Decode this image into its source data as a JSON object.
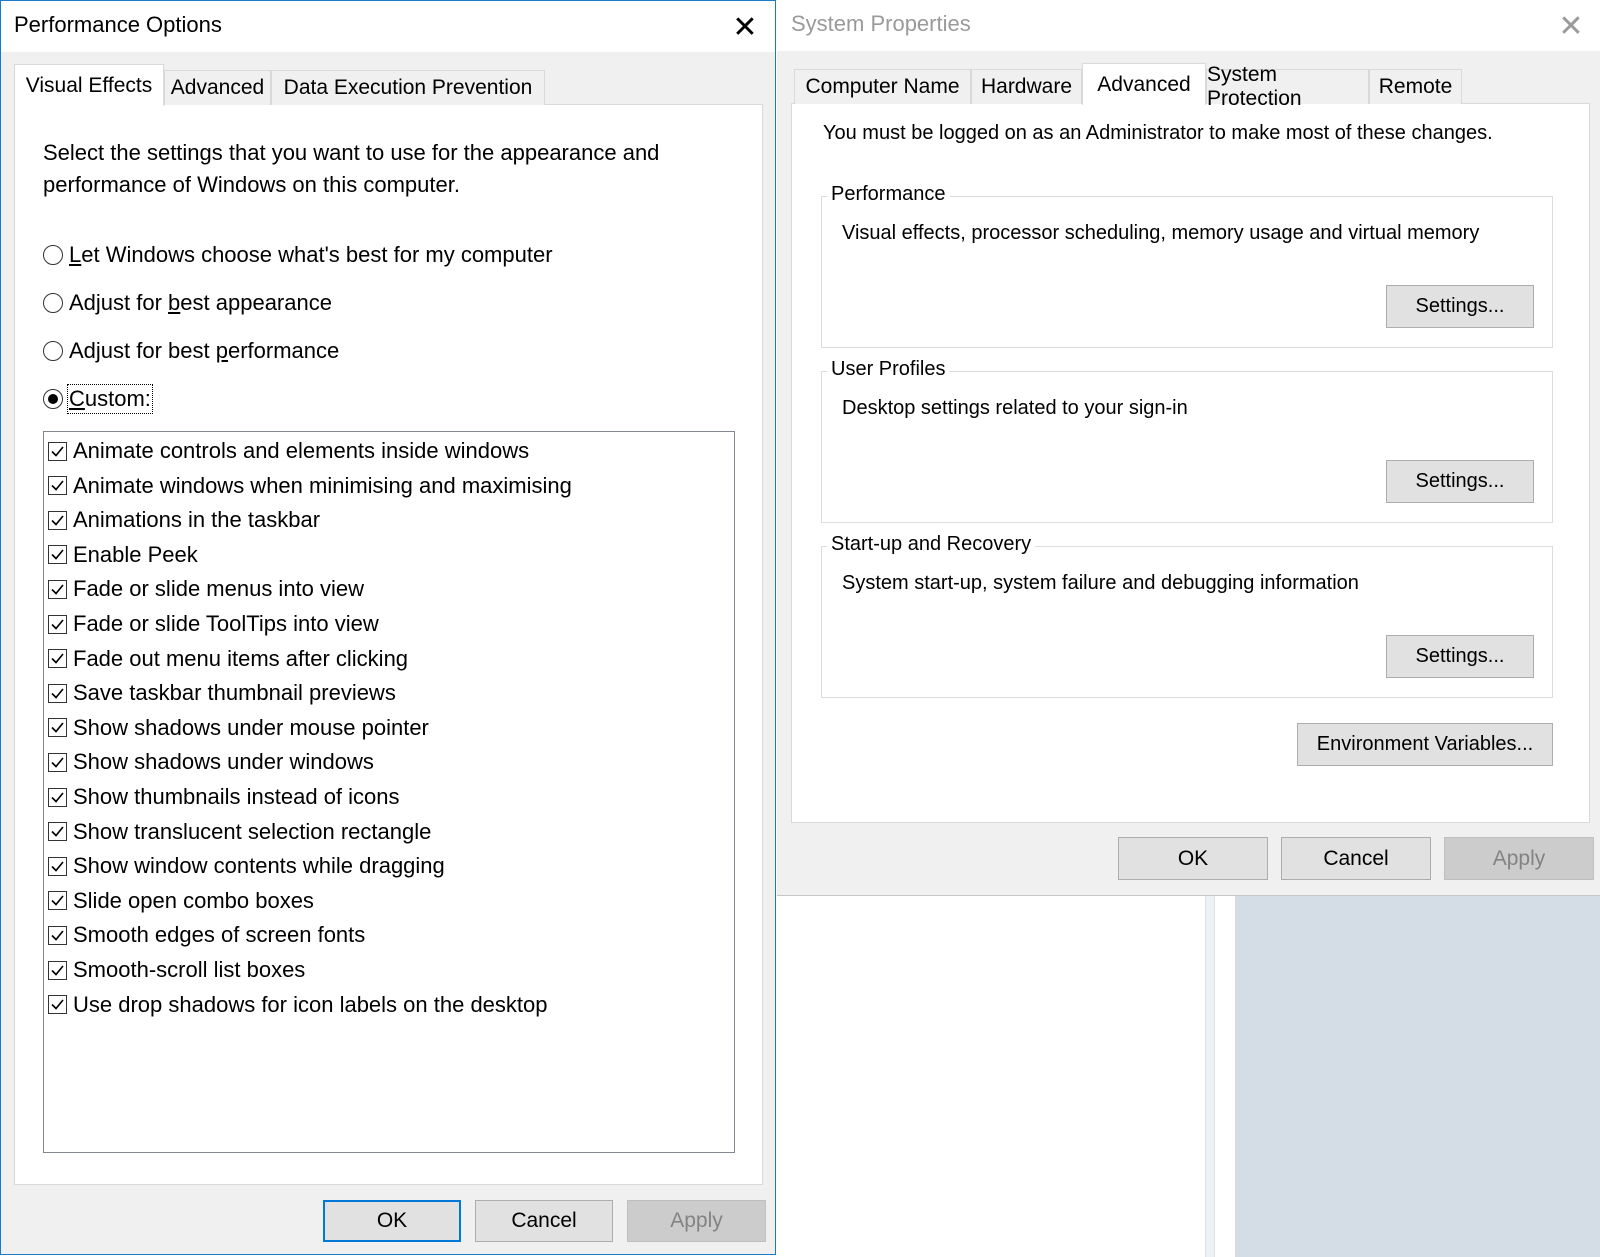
{
  "performance_options": {
    "title": "Performance Options",
    "tabs": [
      {
        "label": "Visual Effects",
        "active": true
      },
      {
        "label": "Advanced",
        "active": false
      },
      {
        "label": "Data Execution Prevention",
        "active": false
      }
    ],
    "description": "Select the settings that you want to use for the appearance and performance of Windows on this computer.",
    "radios": [
      {
        "pre": "",
        "key": "L",
        "post": "et Windows choose what's best for my computer",
        "selected": false
      },
      {
        "pre": "Adjust for ",
        "key": "b",
        "post": "est appearance",
        "selected": false
      },
      {
        "pre": "Adjust for best ",
        "key": "p",
        "post": "erformance",
        "selected": false
      },
      {
        "pre": "",
        "key": "C",
        "post": "ustom:",
        "selected": true
      }
    ],
    "effects": [
      {
        "label": "Animate controls and elements inside windows",
        "checked": true
      },
      {
        "label": "Animate windows when minimising and maximising",
        "checked": true
      },
      {
        "label": "Animations in the taskbar",
        "checked": true
      },
      {
        "label": "Enable Peek",
        "checked": true
      },
      {
        "label": "Fade or slide menus into view",
        "checked": true
      },
      {
        "label": "Fade or slide ToolTips into view",
        "checked": true
      },
      {
        "label": "Fade out menu items after clicking",
        "checked": true
      },
      {
        "label": "Save taskbar thumbnail previews",
        "checked": true
      },
      {
        "label": "Show shadows under mouse pointer",
        "checked": true
      },
      {
        "label": "Show shadows under windows",
        "checked": true
      },
      {
        "label": "Show thumbnails instead of icons",
        "checked": true
      },
      {
        "label": "Show translucent selection rectangle",
        "checked": true
      },
      {
        "label": "Show window contents while dragging",
        "checked": true
      },
      {
        "label": "Slide open combo boxes",
        "checked": true
      },
      {
        "label": "Smooth edges of screen fonts",
        "checked": true
      },
      {
        "label": "Smooth-scroll list boxes",
        "checked": true
      },
      {
        "label": "Use drop shadows for icon labels on the desktop",
        "checked": true
      }
    ],
    "buttons": {
      "ok": "OK",
      "cancel": "Cancel",
      "apply": "Apply"
    },
    "close_glyph": "✕"
  },
  "system_properties": {
    "title": "System Properties",
    "tabs": [
      {
        "label": "Computer Name",
        "active": false
      },
      {
        "label": "Hardware",
        "active": false
      },
      {
        "label": "Advanced",
        "active": true
      },
      {
        "label": "System Protection",
        "active": false
      },
      {
        "label": "Remote",
        "active": false
      }
    ],
    "notice": "You must be logged on as an Administrator to make most of these changes.",
    "groups": [
      {
        "legend": "Performance",
        "description": "Visual effects, processor scheduling, memory usage and virtual memory",
        "button": "Settings..."
      },
      {
        "legend": "User Profiles",
        "description": "Desktop settings related to your sign-in",
        "button": "Settings..."
      },
      {
        "legend": "Start-up and Recovery",
        "description": "System start-up, system failure and debugging information",
        "button": "Settings..."
      }
    ],
    "env_button": "Environment Variables...",
    "buttons": {
      "ok": "OK",
      "cancel": "Cancel",
      "apply": "Apply"
    },
    "close_glyph": "✕"
  },
  "colors": {
    "accent": "#0078d7",
    "window_border": "#1979ca",
    "dialog_background": "#f0f0f0",
    "disabled_text": "#838383",
    "inactive_title": "#9a9a9a"
  }
}
